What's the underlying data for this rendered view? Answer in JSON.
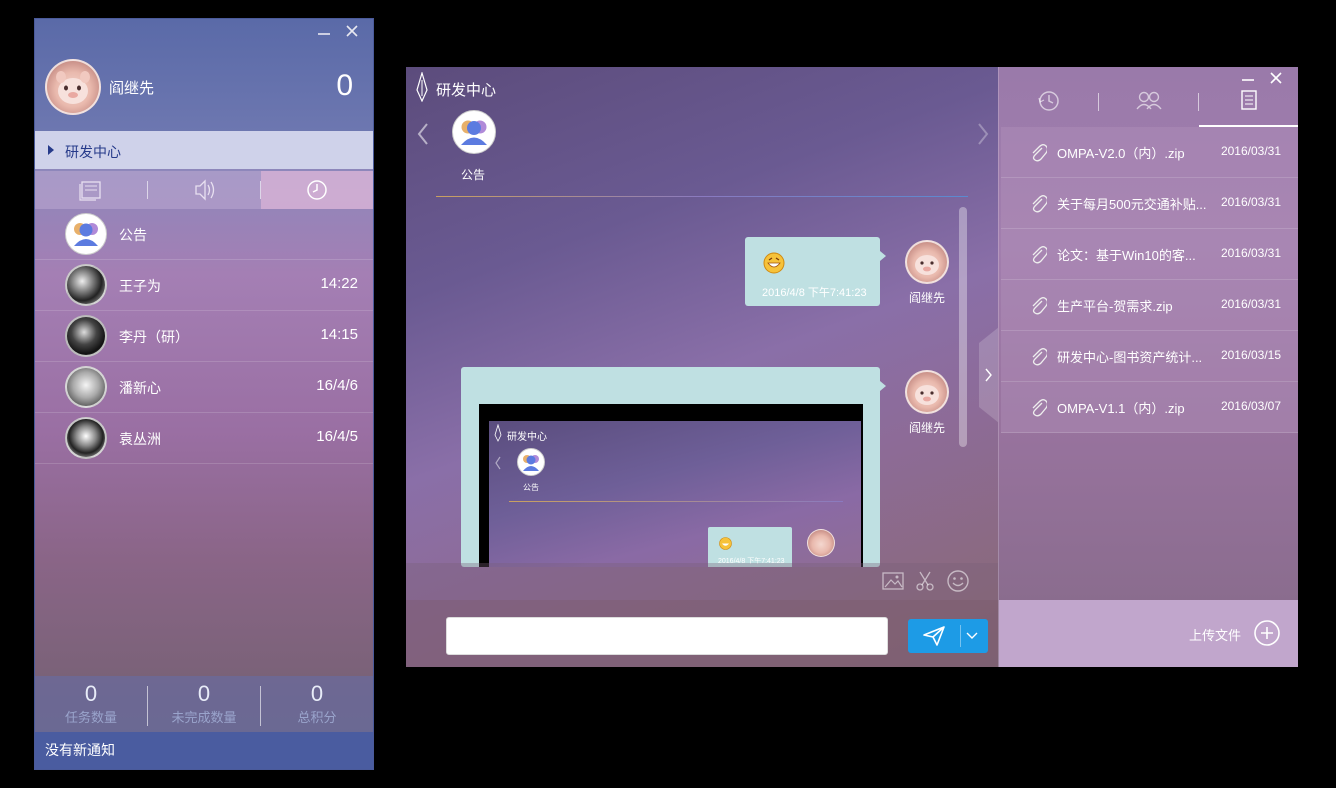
{
  "left_window": {
    "user_name": "阎继先",
    "unread_count": "0",
    "group_name": "研发中心",
    "conversations": [
      {
        "name": "公告",
        "time": "",
        "avatar": "group-icon"
      },
      {
        "name": "王子为",
        "time": "14:22",
        "avatar": "bw1"
      },
      {
        "name": "李丹（研）",
        "time": "14:15",
        "avatar": "bw2"
      },
      {
        "name": "潘新心",
        "time": "16/4/6",
        "avatar": "bw3"
      },
      {
        "name": "袁丛洲",
        "time": "16/4/5",
        "avatar": "bw4"
      }
    ],
    "stats": [
      {
        "value": "0",
        "label": "任务数量"
      },
      {
        "value": "0",
        "label": "未完成数量"
      },
      {
        "value": "0",
        "label": "总积分"
      }
    ],
    "notice": "没有新通知"
  },
  "chat_window": {
    "title": "研发中心",
    "contact_label": "公告",
    "messages": [
      {
        "emoji": "grin-emoji",
        "time": "2016/4/8 下午7:41:23",
        "sender": "阎继先"
      },
      {
        "type": "screenshot",
        "sender": "阎继先"
      }
    ],
    "nested": {
      "title": "研发中心",
      "contact_label": "公告",
      "time": "2016/4/8 下午7:41:23"
    }
  },
  "files_panel": {
    "files": [
      {
        "name": "OMPA-V2.0（内）.zip",
        "date": "2016/03/31"
      },
      {
        "name": "关于每月500元交通补贴...",
        "date": "2016/03/31"
      },
      {
        "name": "论文：基于Win10的客...",
        "date": "2016/03/31"
      },
      {
        "name": "生产平台-贺需求.zip",
        "date": "2016/03/31"
      },
      {
        "name": "研发中心-图书资产统计...",
        "date": "2016/03/15"
      },
      {
        "name": "OMPA-V1.1（内）.zip",
        "date": "2016/03/07"
      }
    ],
    "upload_label": "上传文件"
  },
  "colors": {
    "accent_blue": "#1d9be6",
    "group_bar_text": "#263a8a",
    "bubble": "#bfe0e2"
  }
}
